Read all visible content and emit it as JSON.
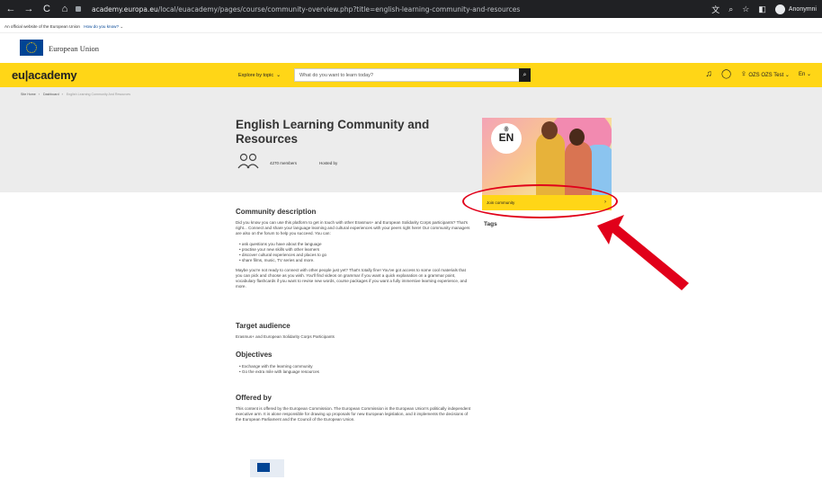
{
  "browser": {
    "back": "←",
    "forward": "→",
    "reload": "C",
    "home": "⌂",
    "url_host": "academy.europa.eu",
    "url_path": "/local/euacademy/pages/course/community-overview.php?title=english-learning-community-and-resources",
    "profile": "Anonymni",
    "icons": [
      "translate-icon",
      "zoom-icon",
      "star-icon",
      "split-icon",
      "profile-icon"
    ]
  },
  "official_banner": {
    "text": "An official website of the European Union",
    "link": "How do you know?"
  },
  "eu_header": {
    "name": "European Union"
  },
  "topbar": {
    "logo": "eu|academy",
    "explore": "Explore by topic",
    "search_placeholder": "What do you want to learn today?",
    "user": "OZS OZS Test",
    "lang": "En"
  },
  "breadcrumb": {
    "items": [
      "Site Home",
      "Dashboard",
      "English Learning Community And Resources"
    ]
  },
  "course": {
    "title": "English Learning Community and Resources",
    "members": "4270 members",
    "hosted_by": "Hosted by",
    "badge_lang": "EN",
    "join": "Join community",
    "tags_heading": "Tags"
  },
  "description": {
    "heading": "Community description",
    "intro": "Did you know you can use this platform to get in touch with other Erasmus+ and European Solidarity Corps participants? That's right... Connect and share your language learning and cultural experiences with your peers right here! Our community managers are also on the forum to help you succeed. You can:",
    "bullets": [
      "ask questions you have about the language",
      "practise your new skills with other learners",
      "discover cultural experiences and places to go",
      "share films, music, TV series and more."
    ],
    "outro": "Maybe you're not ready to connect with other people just yet? That's totally fine! You've got access to some cool materials that you can pick and choose as you wish. You'll find videos on grammar if you want a quick explanation on a grammar point, vocabulary flashcards if you want to revise new words, course packages if you want a fully immersive learning experience, and more."
  },
  "audience": {
    "heading": "Target audience",
    "text": "Erasmus+ and European Solidarity Corps Participants"
  },
  "objectives": {
    "heading": "Objectives",
    "items": [
      "Exchange with the learning community",
      "Go the extra mile with language resources"
    ]
  },
  "offered": {
    "heading": "Offered by",
    "text": "This content is offered by the European Commission. The European Commission is the European Union's politically independent executive arm. It is alone responsible for drawing up proposals for new European legislation, and it implements the decisions of the European Parliament and the Council of the European Union."
  },
  "colors": {
    "accent": "#ffd617",
    "eu_blue": "#004494",
    "highlight": "#e1001a"
  }
}
